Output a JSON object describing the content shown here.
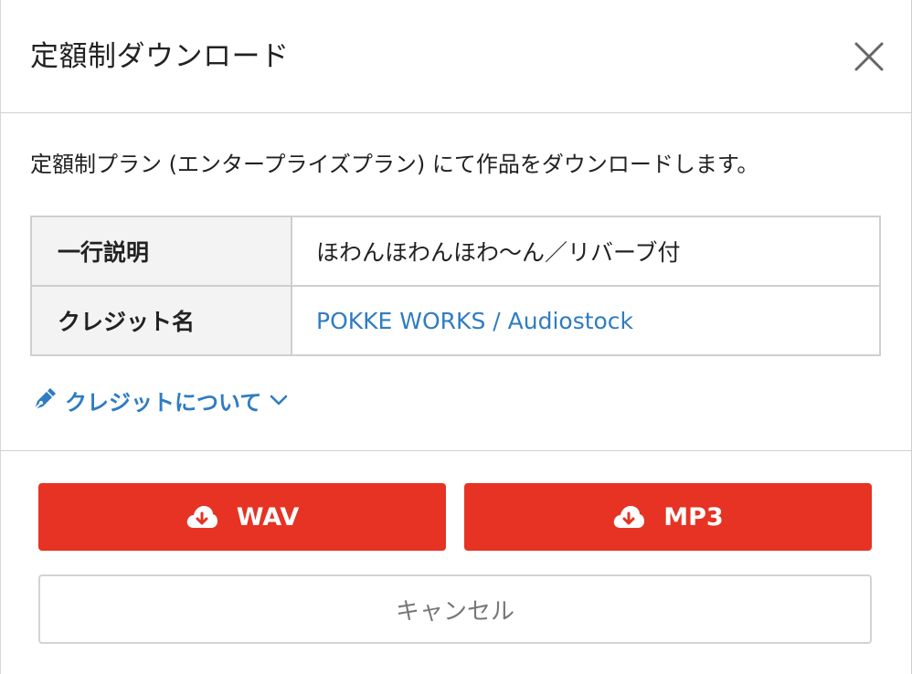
{
  "dialog": {
    "title": "定額制ダウンロード",
    "close_icon": "close-icon"
  },
  "body": {
    "intro": "定額制プラン (エンタープライズプラン) にて作品をダウンロードします。",
    "table": {
      "rows": [
        {
          "label": "一行説明",
          "value": "ほわんほわんほわ〜ん／リバーブ付"
        },
        {
          "label": "クレジット名",
          "value": "POKKE WORKS / Audiostock"
        }
      ]
    },
    "credit_toggle": {
      "label": "クレジットについて",
      "icon": "pen-icon",
      "chevron": "chevron-down-icon"
    }
  },
  "footer": {
    "wav_label": "WAV",
    "mp3_label": "MP3",
    "cancel_label": "キャンセル",
    "download_icon": "cloud-download-icon"
  },
  "colors": {
    "accent_red": "#e63323",
    "link_blue": "#2f7cc2",
    "border": "#cfcfcf",
    "label_bg": "#f3f3f3"
  }
}
